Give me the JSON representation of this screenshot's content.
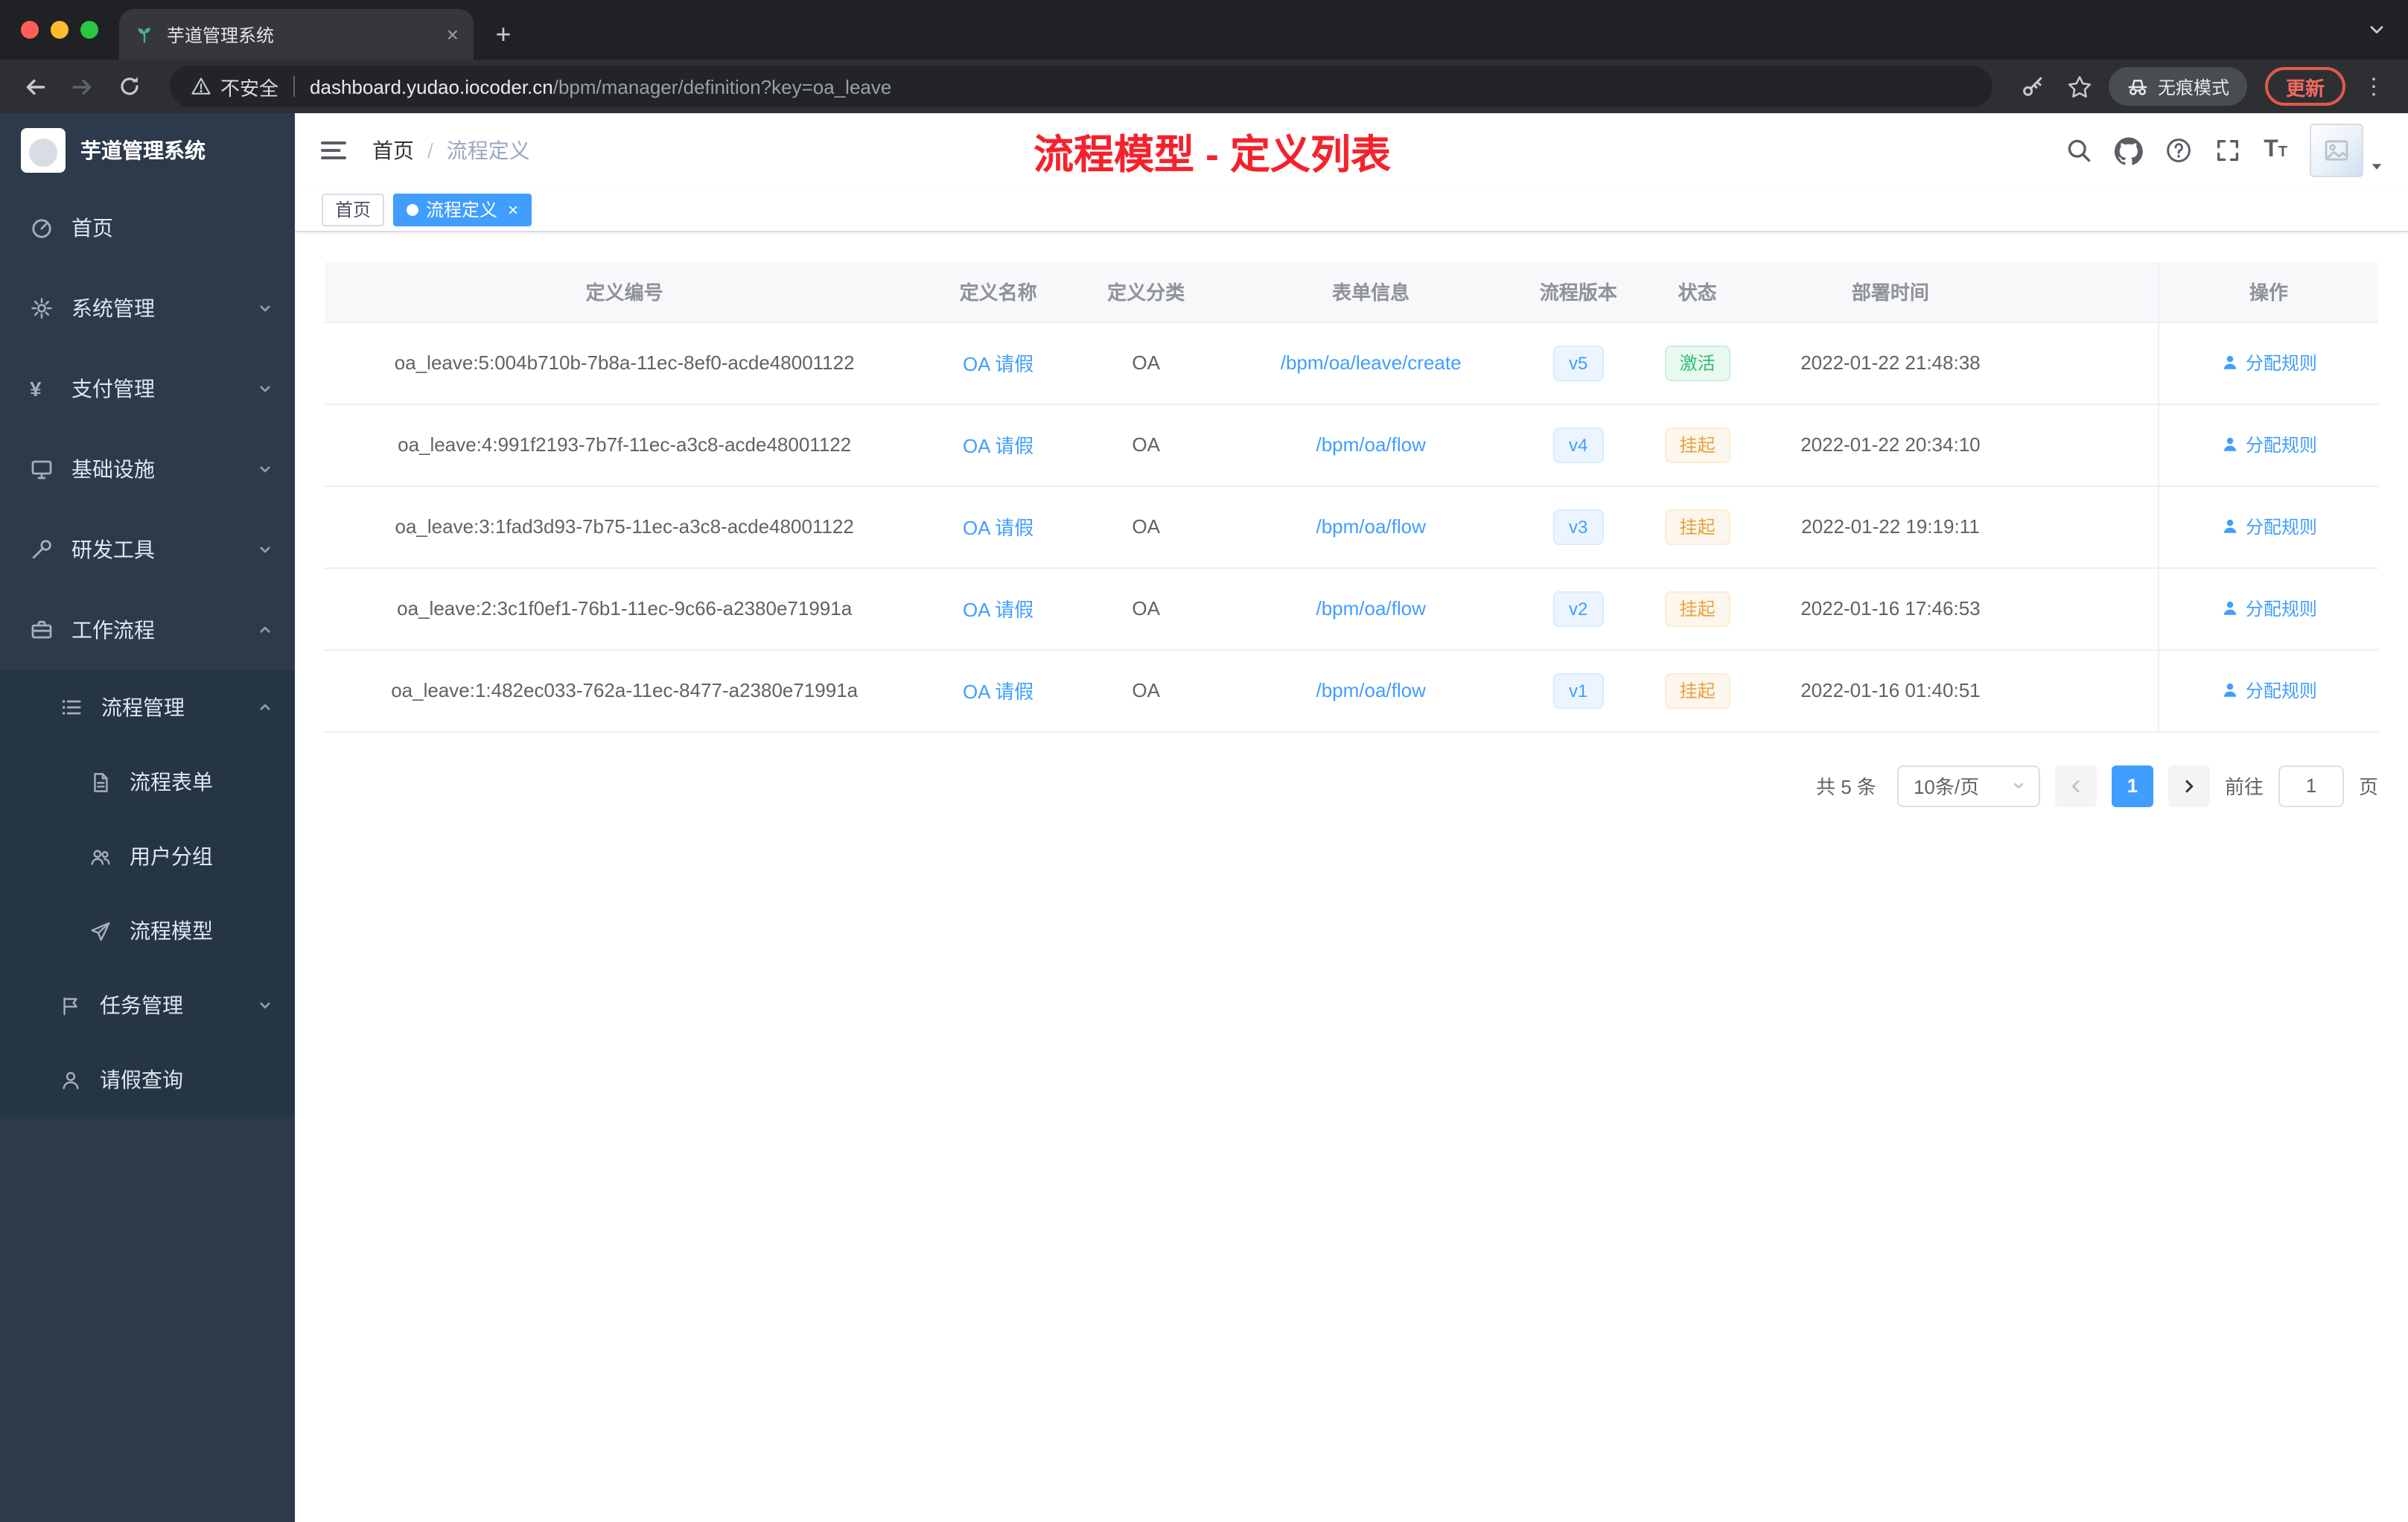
{
  "colors": {
    "accent": "#409eff",
    "title_red": "#f5222d",
    "success": "#2fbf71",
    "warning": "#e6a23c",
    "sidebar_bg": "#2d3a4b"
  },
  "browser": {
    "tab_title": "芋道管理系统",
    "not_secure_label": "不安全",
    "url_host": "dashboard.yudao.iocoder.cn",
    "url_path": "/bpm/manager/definition?key=oa_leave",
    "incognito_label": "无痕模式",
    "update_label": "更新"
  },
  "icons": {
    "tab_close": "×",
    "new_tab": "+",
    "more_vert": "⋮",
    "tag_close": "×",
    "yen": "¥",
    "font_big": "T",
    "font_small": "T"
  },
  "sidebar": {
    "logo_title": "芋道管理系统",
    "items": [
      {
        "label": "首页"
      },
      {
        "label": "系统管理"
      },
      {
        "label": "支付管理"
      },
      {
        "label": "基础设施"
      },
      {
        "label": "研发工具"
      },
      {
        "label": "工作流程"
      },
      {
        "label": "流程管理"
      },
      {
        "label": "流程表单"
      },
      {
        "label": "用户分组"
      },
      {
        "label": "流程模型"
      },
      {
        "label": "任务管理"
      },
      {
        "label": "请假查询"
      }
    ]
  },
  "header": {
    "breadcrumb_home": "首页",
    "breadcrumb_current": "流程定义",
    "page_title": "流程模型 - 定义列表"
  },
  "tags": {
    "home": "首页",
    "active": "流程定义"
  },
  "table": {
    "headers": [
      "定义编号",
      "定义名称",
      "定义分类",
      "表单信息",
      "流程版本",
      "状态",
      "部署时间",
      "操作"
    ],
    "rows": [
      {
        "id": "oa_leave:5:004b710b-7b8a-11ec-8ef0-acde48001122",
        "name": "OA 请假",
        "category": "OA",
        "form": "/bpm/oa/leave/create",
        "version": "v5",
        "status": "激活",
        "deploy_time": "2022-01-22 21:48:38",
        "action": "分配规则"
      },
      {
        "id": "oa_leave:4:991f2193-7b7f-11ec-a3c8-acde48001122",
        "name": "OA 请假",
        "category": "OA",
        "form": "/bpm/oa/flow",
        "version": "v4",
        "status": "挂起",
        "deploy_time": "2022-01-22 20:34:10",
        "action": "分配规则"
      },
      {
        "id": "oa_leave:3:1fad3d93-7b75-11ec-a3c8-acde48001122",
        "name": "OA 请假",
        "category": "OA",
        "form": "/bpm/oa/flow",
        "version": "v3",
        "status": "挂起",
        "deploy_time": "2022-01-22 19:19:11",
        "action": "分配规则"
      },
      {
        "id": "oa_leave:2:3c1f0ef1-76b1-11ec-9c66-a2380e71991a",
        "name": "OA 请假",
        "category": "OA",
        "form": "/bpm/oa/flow",
        "version": "v2",
        "status": "挂起",
        "deploy_time": "2022-01-16 17:46:53",
        "action": "分配规则"
      },
      {
        "id": "oa_leave:1:482ec033-762a-11ec-8477-a2380e71991a",
        "name": "OA 请假",
        "category": "OA",
        "form": "/bpm/oa/flow",
        "version": "v1",
        "status": "挂起",
        "deploy_time": "2022-01-16 01:40:51",
        "action": "分配规则"
      }
    ]
  },
  "pagination": {
    "total": "共 5 条",
    "page_size": "10条/页",
    "current_page": "1",
    "goto_prefix": "前往",
    "goto_value": "1",
    "goto_suffix": "页"
  }
}
